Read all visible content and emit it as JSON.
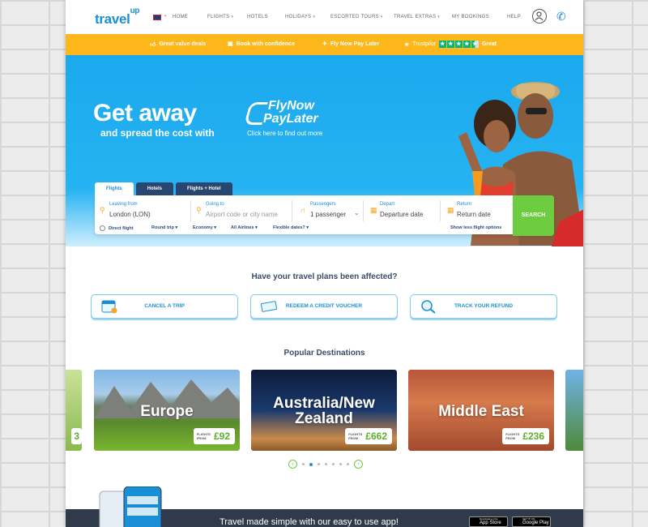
{
  "header": {
    "logo": "travel",
    "logo_sup": "up",
    "nav": [
      {
        "label": "HOME",
        "caret": false
      },
      {
        "label": "FLIGHTS",
        "caret": true
      },
      {
        "label": "HOTELS",
        "caret": false
      },
      {
        "label": "HOLIDAYS",
        "caret": true
      },
      {
        "label": "ESCORTED TOURS",
        "caret": true
      },
      {
        "label": "TRAVEL EXTRAS",
        "caret": true
      },
      {
        "label": "MY BOOKINGS",
        "caret": false
      },
      {
        "label": "HELP",
        "caret": false
      }
    ]
  },
  "promo": {
    "items": [
      "Great value deals",
      "Book with confidence",
      "Fly Now Pay Later"
    ],
    "trustpilot": "Trustpilot",
    "rating_text": "Great",
    "stars": 4.5,
    "star_color": "#00b67a",
    "bg_color": "#fdb71a"
  },
  "hero": {
    "headline": "Get away",
    "subline": "and spread the cost with",
    "brand_line1": "FlyNow",
    "brand_line2": "PayLater",
    "brand_sub": "Click here to find out more"
  },
  "search": {
    "tabs": [
      "Flights",
      "Hotels",
      "Flights + Hotel"
    ],
    "active_tab": 0,
    "from_label": "Leaving from",
    "from_value": "London (LON)",
    "to_label": "Going to",
    "to_placeholder": "Airport code or city name",
    "pax_label": "Passengers",
    "pax_value": "1 passenger",
    "depart_label": "Depart",
    "depart_placeholder": "Departure date",
    "return_label": "Return",
    "return_placeholder": "Return date",
    "button": "SEARCH",
    "options": {
      "direct": "Direct flight",
      "trip": "Round trip",
      "cabin": "Economy",
      "airlines": "All Airlines",
      "flexible": "Flexible dates?",
      "less": "Show less flight options"
    },
    "button_color": "#6dcc3f"
  },
  "affected": {
    "title": "Have your travel plans been affected?",
    "buttons": [
      "CANCEL A TRIP",
      "REDEEM A CREDIT VOUCHER",
      "TRACK YOUR REFUND"
    ]
  },
  "popular": {
    "title": "Popular Destinations",
    "price_label_1": "FLIGHTS",
    "price_label_2": "FROM",
    "cards": [
      {
        "name": "Europe",
        "price": "£92"
      },
      {
        "name": "Australia/New Zealand",
        "name_l1": "Australia/New",
        "name_l2": "Zealand",
        "price": "£662"
      },
      {
        "name": "Middle East",
        "price": "£236"
      }
    ],
    "partial_left_price": "3",
    "page_count": 7,
    "active_page": 1
  },
  "app": {
    "text": "Travel made simple with our easy to use app!",
    "appstore_small": "Download on the",
    "appstore": "App Store",
    "play_small": "GET IT ON",
    "play": "Google Play"
  }
}
